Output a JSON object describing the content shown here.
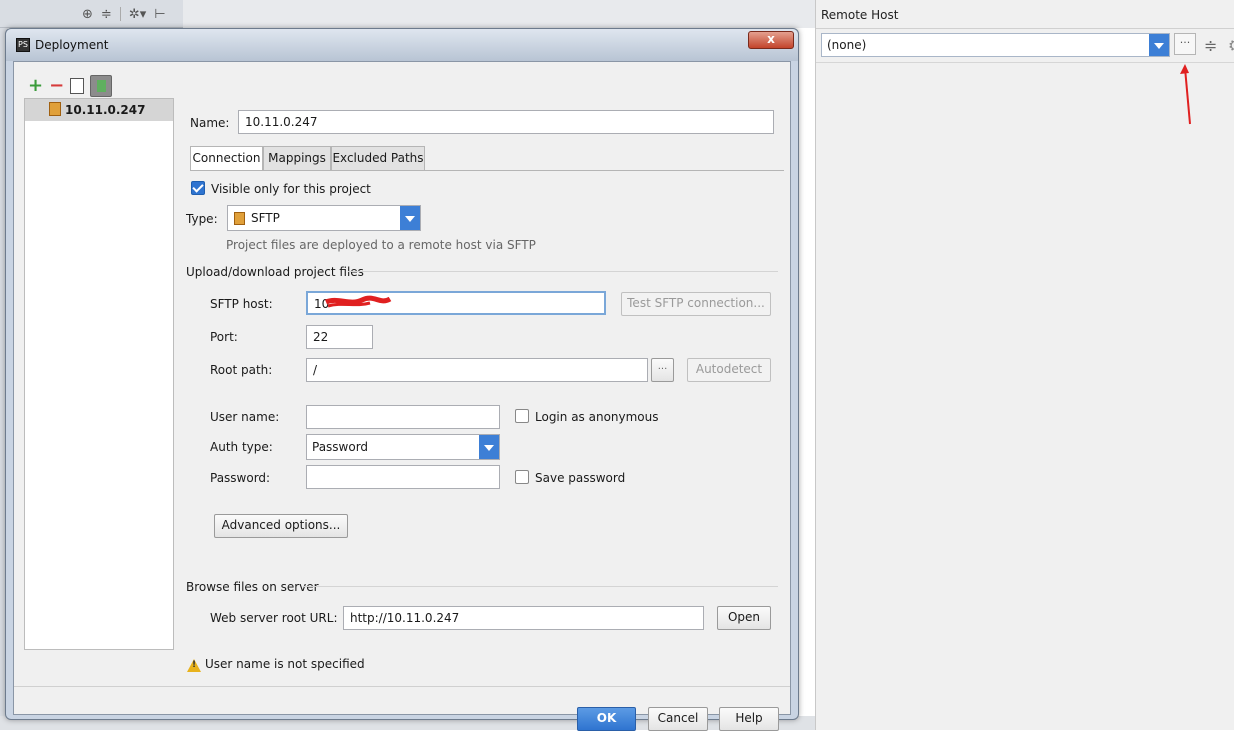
{
  "ide": {
    "toolbar_icons": [
      "target-icon",
      "collapse-icon",
      "gear-icon",
      "pin-icon"
    ]
  },
  "remote_host": {
    "title": "Remote Host",
    "selected": "(none)",
    "browse_label": "···"
  },
  "dialog": {
    "title": "Deployment",
    "close_label": "x",
    "servers": [
      "10.11.0.247"
    ],
    "name_label": "Name:",
    "name_value": "10.11.0.247",
    "tabs": [
      "Connection",
      "Mappings",
      "Excluded Paths"
    ],
    "active_tab": "Connection",
    "visible_only_label": "Visible only for this project",
    "visible_only_checked": true,
    "type_label": "Type:",
    "type_value": "SFTP",
    "type_hint": "Project files are deployed to a remote host via SFTP",
    "upload_section": "Upload/download project files",
    "sftp_host_label": "SFTP host:",
    "sftp_host_value": "10",
    "test_connection_label": "Test SFTP connection...",
    "port_label": "Port:",
    "port_value": "22",
    "root_path_label": "Root path:",
    "root_path_value": "/",
    "root_path_browse": "···",
    "autodetect_label": "Autodetect",
    "user_name_label": "User name:",
    "user_name_value": "",
    "login_anonymous_label": "Login as anonymous",
    "login_anonymous_checked": false,
    "auth_type_label": "Auth type:",
    "auth_type_value": "Password",
    "password_label": "Password:",
    "password_value": "",
    "save_password_label": "Save password",
    "save_password_checked": false,
    "advanced_options_label": "Advanced options...",
    "browse_section": "Browse files on server",
    "web_root_label": "Web server root URL:",
    "web_root_value": "http://10.11.0.247",
    "open_label": "Open",
    "warning_text": "User name is not specified",
    "ok_label": "OK",
    "cancel_label": "Cancel",
    "help_label": "Help"
  },
  "colors": {
    "accent": "#2f74d0",
    "dropdown_arrow": "#3d7fd6",
    "annotation_red": "#e02020",
    "warning": "#e8b21c"
  }
}
